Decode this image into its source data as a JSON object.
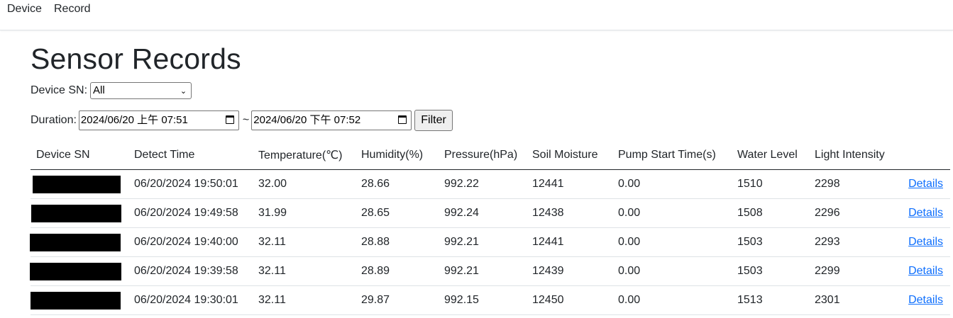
{
  "nav": {
    "items": [
      {
        "label": "Device"
      },
      {
        "label": "Record"
      }
    ]
  },
  "page": {
    "title": "Sensor Records"
  },
  "filters": {
    "device_sn_label": "Device SN:",
    "device_sn_selected": "All",
    "duration_label": "Duration:",
    "start_value": "2024/06/20 上午 07:51",
    "separator": "~",
    "end_value": "2024/06/20 下午 07:52",
    "filter_button": "Filter"
  },
  "table": {
    "columns": [
      "Device SN",
      "Detect Time",
      "Temperature(℃)",
      "Humidity(%)",
      "Pressure(hPa)",
      "Soil Moisture",
      "Pump Start Time(s)",
      "Water Level",
      "Light Intensity",
      ""
    ],
    "rows": [
      {
        "device_sn_redacted": true,
        "detect_time": "06/20/2024 19:50:01",
        "temperature": "32.00",
        "humidity": "28.66",
        "pressure": "992.22",
        "soil_moisture": "12441",
        "pump_start": "0.00",
        "water_level": "1510",
        "light": "2298",
        "details": "Details"
      },
      {
        "device_sn_redacted": true,
        "detect_time": "06/20/2024 19:49:58",
        "temperature": "31.99",
        "humidity": "28.65",
        "pressure": "992.24",
        "soil_moisture": "12438",
        "pump_start": "0.00",
        "water_level": "1508",
        "light": "2296",
        "details": "Details"
      },
      {
        "device_sn_redacted": true,
        "detect_time": "06/20/2024 19:40:00",
        "temperature": "32.11",
        "humidity": "28.88",
        "pressure": "992.21",
        "soil_moisture": "12441",
        "pump_start": "0.00",
        "water_level": "1503",
        "light": "2293",
        "details": "Details"
      },
      {
        "device_sn_redacted": true,
        "detect_time": "06/20/2024 19:39:58",
        "temperature": "32.11",
        "humidity": "28.89",
        "pressure": "992.21",
        "soil_moisture": "12439",
        "pump_start": "0.00",
        "water_level": "1503",
        "light": "2299",
        "details": "Details"
      },
      {
        "device_sn_redacted": true,
        "detect_time": "06/20/2024 19:30:01",
        "temperature": "32.11",
        "humidity": "29.87",
        "pressure": "992.15",
        "soil_moisture": "12450",
        "pump_start": "0.00",
        "water_level": "1513",
        "light": "2301",
        "details": "Details"
      }
    ]
  },
  "colors": {
    "link": "#0d6efd",
    "text": "#212529",
    "redaction": "#000000"
  },
  "icons": {
    "select_arrow": "chevron-down-icon",
    "date_picker": "calendar-icon"
  }
}
